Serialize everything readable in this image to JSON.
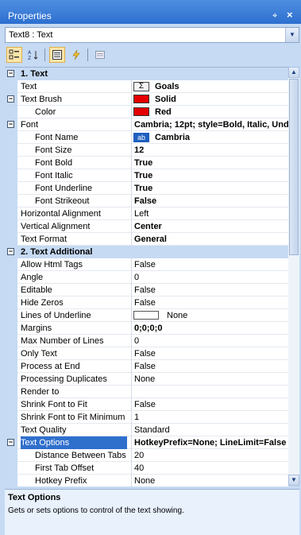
{
  "panel": {
    "title": "Properties",
    "pin_glyph": "⌖",
    "close_glyph": "×"
  },
  "object_selector": {
    "value": "Text8 : Text"
  },
  "toolbar": {
    "icons": [
      "categorized-icon",
      "alphabetical-icon",
      "properties-icon",
      "events-icon",
      "property-pages-icon"
    ]
  },
  "colors": {
    "swatch_red": "#e40000",
    "swatch_white": "#ffffff",
    "category_bg": "#c6daf3",
    "selection": "#2f6fcc"
  },
  "rows": [
    {
      "type": "cat",
      "expander": "−",
      "name": "1. Text"
    },
    {
      "name": "Text",
      "icon": "sigma",
      "value": "Goals",
      "bold": true
    },
    {
      "name": "Text Brush",
      "expander": "−",
      "swatch": "#e40000",
      "value": "Solid",
      "bold": true
    },
    {
      "name": "Color",
      "indent": true,
      "swatch": "#e40000",
      "value": "Red",
      "bold": true
    },
    {
      "name": "Font",
      "expander": "−",
      "value": "Cambria; 12pt; style=Bold, Italic, Und",
      "bold": true
    },
    {
      "name": "Font Name",
      "indent": true,
      "icon": "ab",
      "value": "Cambria",
      "bold": true
    },
    {
      "name": "Font Size",
      "indent": true,
      "value": "12",
      "bold": true
    },
    {
      "name": "Font Bold",
      "indent": true,
      "value": "True",
      "bold": true
    },
    {
      "name": "Font Italic",
      "indent": true,
      "value": "True",
      "bold": true
    },
    {
      "name": "Font Underline",
      "indent": true,
      "value": "True",
      "bold": true
    },
    {
      "name": "Font Strikeout",
      "indent": true,
      "value": "False",
      "bold": true
    },
    {
      "name": "Horizontal Alignment",
      "value": "Left"
    },
    {
      "name": "Vertical Alignment",
      "value": "Center",
      "bold": true
    },
    {
      "name": "Text Format",
      "value": "General",
      "bold": true
    },
    {
      "type": "cat",
      "expander": "−",
      "name": "2. Text  Additional"
    },
    {
      "name": "Allow Html Tags",
      "value": "False"
    },
    {
      "name": "Angle",
      "value": "0"
    },
    {
      "name": "Editable",
      "value": "False"
    },
    {
      "name": "Hide Zeros",
      "value": "False"
    },
    {
      "name": "Lines of Underline",
      "swatch": "#ffffff",
      "value": "None",
      "wide_swatch": true
    },
    {
      "name": "Margins",
      "value": "0;0;0;0",
      "bold": true
    },
    {
      "name": "Max Number of Lines",
      "value": "0"
    },
    {
      "name": "Only Text",
      "value": "False"
    },
    {
      "name": "Process at End",
      "value": "False"
    },
    {
      "name": "Processing Duplicates",
      "value": "None"
    },
    {
      "name": "Render to",
      "value": ""
    },
    {
      "name": "Shrink Font to Fit",
      "value": "False"
    },
    {
      "name": "Shrink Font to Fit Minimum S",
      "value": "1"
    },
    {
      "name": "Text Quality",
      "value": "Standard"
    },
    {
      "name": "Text Options",
      "expander": "−",
      "selected": true,
      "value": "HotkeyPrefix=None; LineLimit=False",
      "bold": true
    },
    {
      "name": "Distance Between Tabs",
      "indent": true,
      "value": "20"
    },
    {
      "name": "First Tab Offset",
      "indent": true,
      "value": "40"
    },
    {
      "name": "Hotkey Prefix",
      "indent": true,
      "value": "None"
    }
  ],
  "description": {
    "title": "Text Options",
    "text": "Gets or sets options to control of the text showing."
  }
}
